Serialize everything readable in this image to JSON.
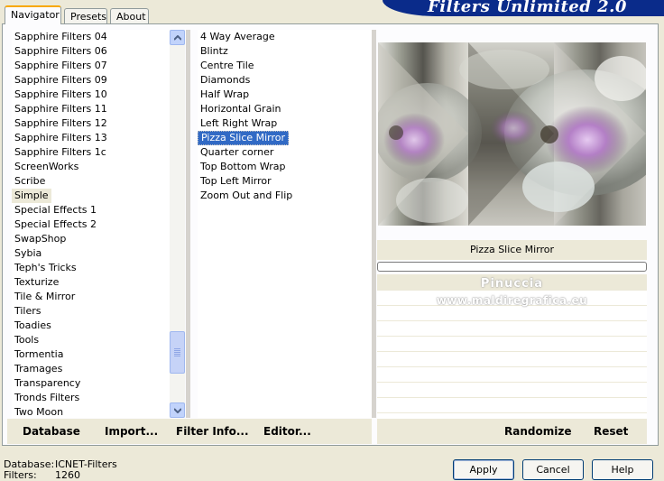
{
  "tabs": [
    "Navigator",
    "Presets",
    "About"
  ],
  "logo_text": "Filters Unlimited 2.0",
  "categories": [
    "Sapphire Filters 04",
    "Sapphire Filters 06",
    "Sapphire Filters 07",
    "Sapphire Filters 09",
    "Sapphire Filters 10",
    "Sapphire Filters 11",
    "Sapphire Filters 12",
    "Sapphire Filters 13",
    "Sapphire Filters 1c",
    "ScreenWorks",
    "Scribe",
    "Simple",
    "Special Effects 1",
    "Special Effects 2",
    "SwapShop",
    "Sybia",
    "Teph's Tricks",
    "Texturize",
    "Tile & Mirror",
    "Tilers",
    "Toadies",
    "Tools",
    "Tormentia",
    "Tramages",
    "Transparency",
    "Tronds Filters",
    "Two Moon"
  ],
  "highlighted_category": "Simple",
  "filters": [
    "4 Way Average",
    "Blintz",
    "Centre Tile",
    "Diamonds",
    "Half Wrap",
    "Horizontal Grain",
    "Left Right Wrap",
    "Pizza Slice Mirror",
    "Quarter corner",
    "Top Bottom Wrap",
    "Top Left Mirror",
    "Zoom Out and Flip"
  ],
  "selected_filter": "Pizza Slice Mirror",
  "preview_filter_name": "Pizza Slice Mirror",
  "watermark": {
    "line1": "Pinuccia",
    "line2": "www.maldiregrafica.eu"
  },
  "bottom_buttons": {
    "database": "Database",
    "import": "Import...",
    "filter_info": "Filter Info...",
    "editor": "Editor...",
    "randomize": "Randomize",
    "reset": "Reset"
  },
  "status": {
    "database_label": "Database:",
    "database_value": "ICNET-Filters",
    "filters_label": "Filters:",
    "filters_value": "1260"
  },
  "dialog_buttons": {
    "apply": "Apply",
    "cancel": "Cancel",
    "help": "Help"
  },
  "colors": {
    "selection": "#316ac5",
    "logo_bg": "#0a2b8a",
    "panel_bg": "#ece9d8"
  }
}
